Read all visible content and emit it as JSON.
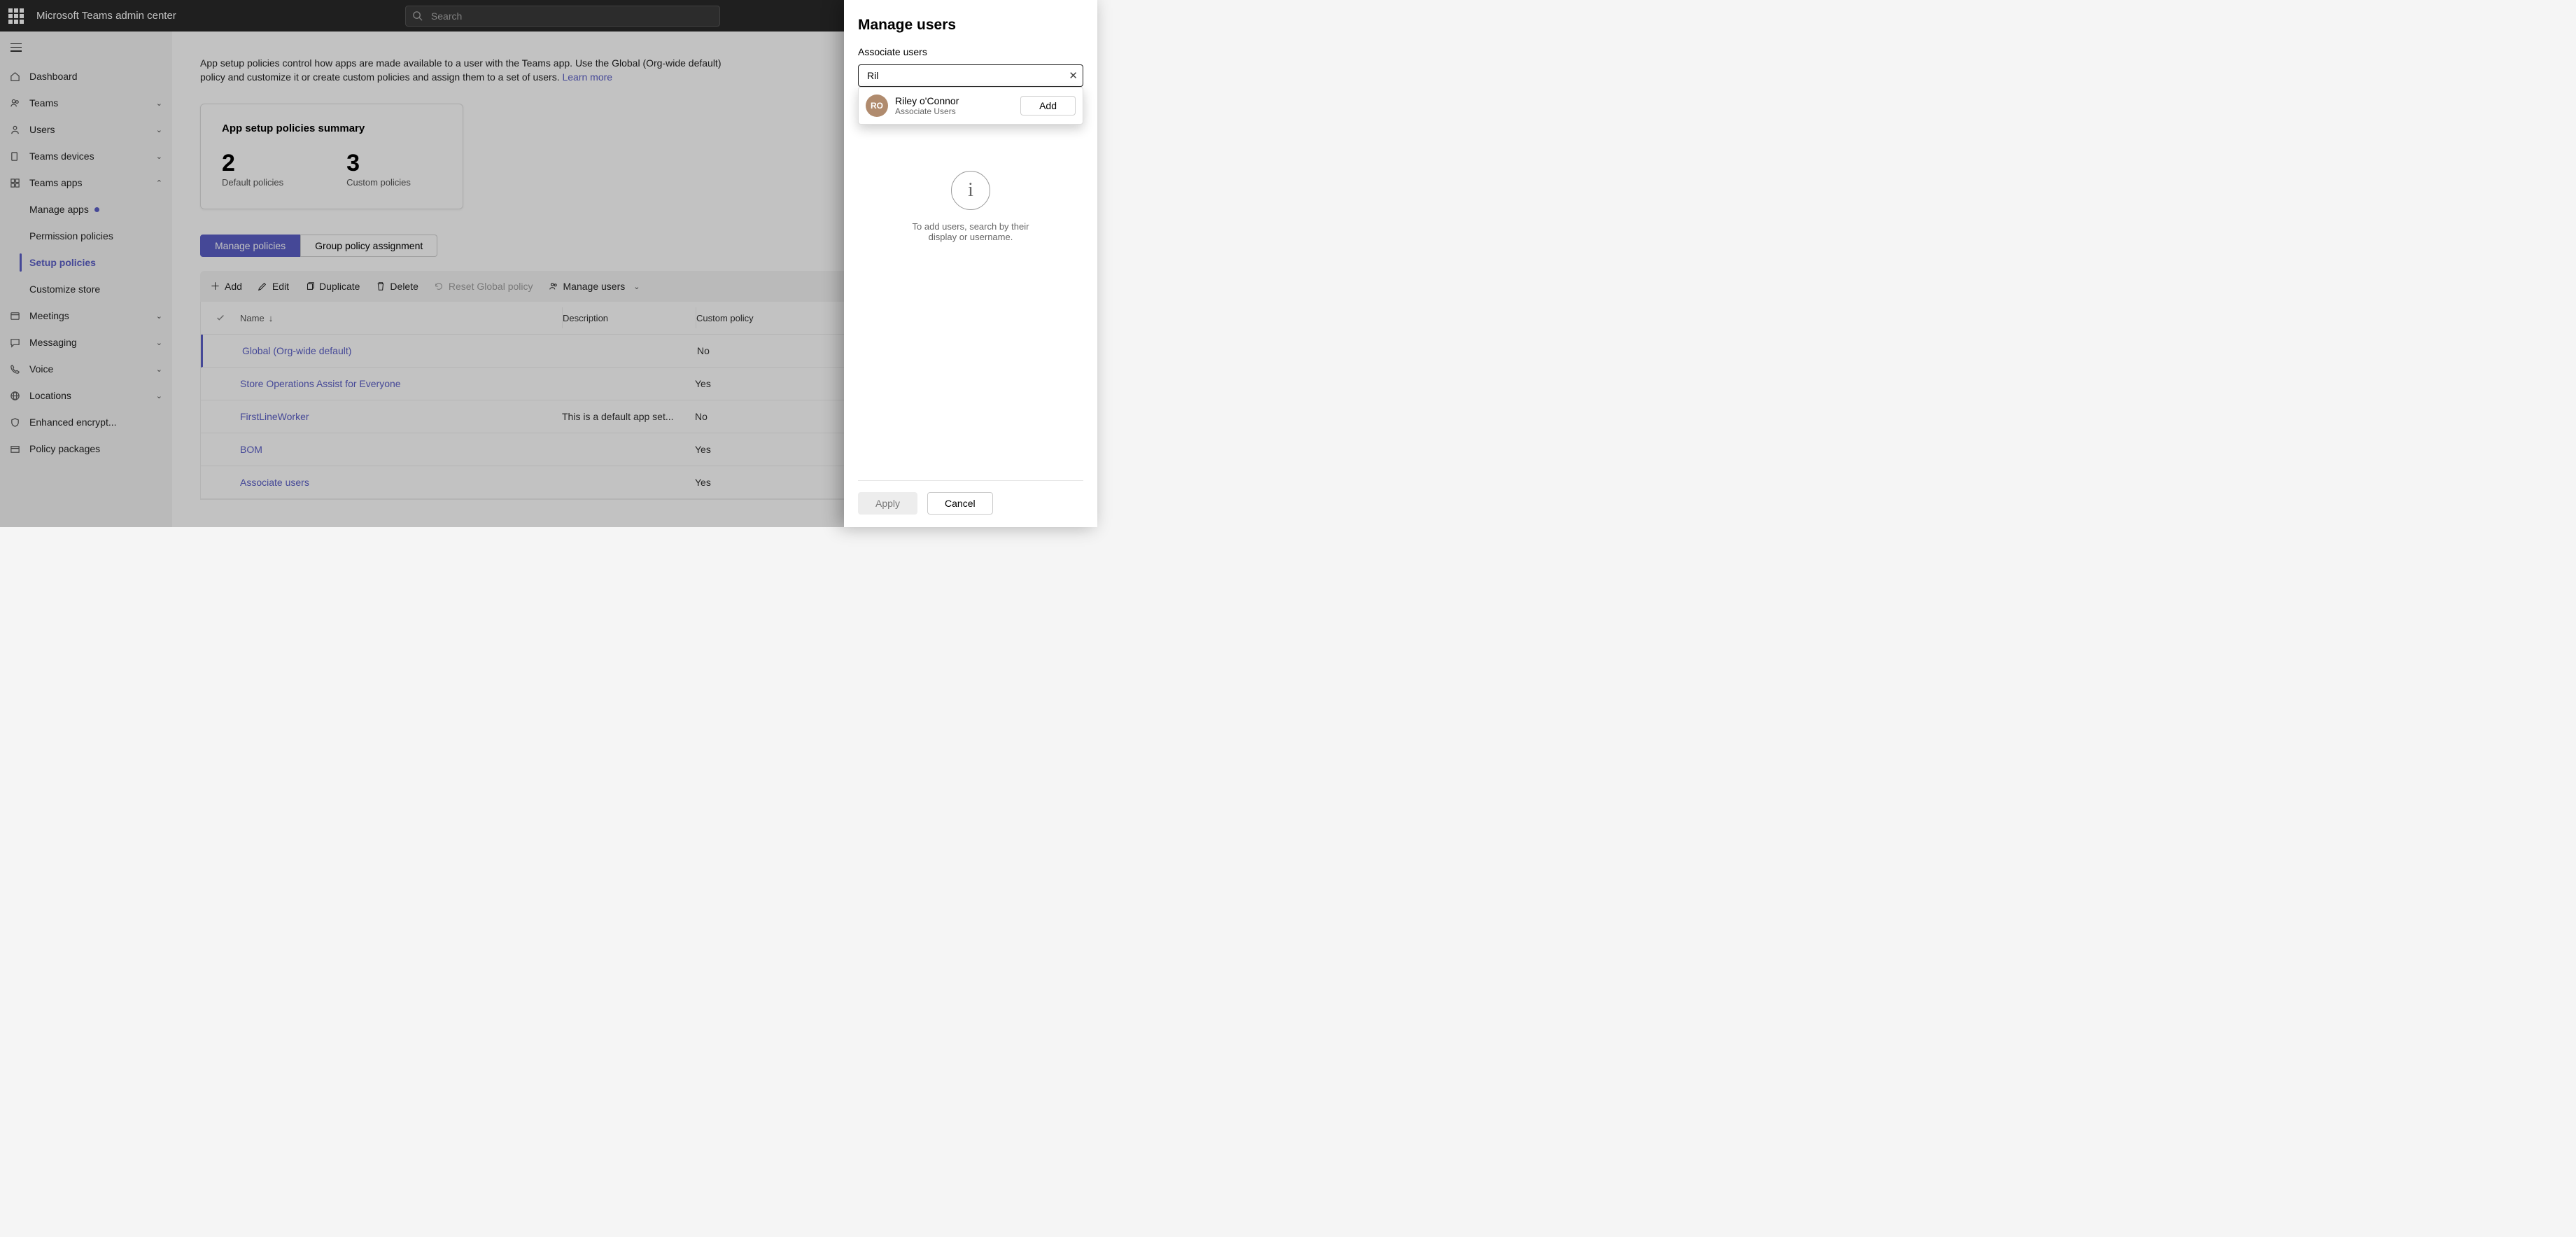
{
  "header": {
    "app_title": "Microsoft Teams admin center",
    "search_placeholder": "Search"
  },
  "nav": {
    "dashboard": "Dashboard",
    "teams": "Teams",
    "users": "Users",
    "teams_devices": "Teams devices",
    "teams_apps": "Teams apps",
    "manage_apps": "Manage apps",
    "permission_policies": "Permission policies",
    "setup_policies": "Setup policies",
    "customize_store": "Customize store",
    "meetings": "Meetings",
    "messaging": "Messaging",
    "voice": "Voice",
    "locations": "Locations",
    "enhanced_encrypt": "Enhanced encrypt...",
    "policy_packages": "Policy packages"
  },
  "page": {
    "description": "App setup policies control how apps are made available to a user with the Teams app. Use the Global (Org-wide default) policy and customize it or create custom policies and assign them to a set of users. ",
    "learn_more": "Learn more"
  },
  "card": {
    "title": "App setup policies summary",
    "default_count": "2",
    "default_label": "Default policies",
    "custom_count": "3",
    "custom_label": "Custom policies"
  },
  "tabs": {
    "manage": "Manage policies",
    "group": "Group policy assignment"
  },
  "toolbar": {
    "add": "Add",
    "edit": "Edit",
    "duplicate": "Duplicate",
    "delete": "Delete",
    "reset": "Reset Global policy",
    "manage_users": "Manage users"
  },
  "table": {
    "h_name": "Name",
    "h_desc": "Description",
    "h_custom": "Custom policy",
    "rows": [
      {
        "name": "Global (Org-wide default)",
        "desc": "",
        "custom": "No"
      },
      {
        "name": "Store Operations Assist for Everyone",
        "desc": "",
        "custom": "Yes"
      },
      {
        "name": "FirstLineWorker",
        "desc": "This is a default app set...",
        "custom": "No"
      },
      {
        "name": "BOM",
        "desc": "",
        "custom": "Yes"
      },
      {
        "name": "Associate users",
        "desc": "",
        "custom": "Yes"
      }
    ]
  },
  "panel": {
    "title": "Manage users",
    "label": "Associate users",
    "search_value": "Ril",
    "suggest": {
      "initials": "RO",
      "name": "Riley o'Connor",
      "sub": "Associate Users",
      "add": "Add"
    },
    "empty_line1": "To add users, search by their",
    "empty_line2": "display or username.",
    "apply": "Apply",
    "cancel": "Cancel"
  }
}
